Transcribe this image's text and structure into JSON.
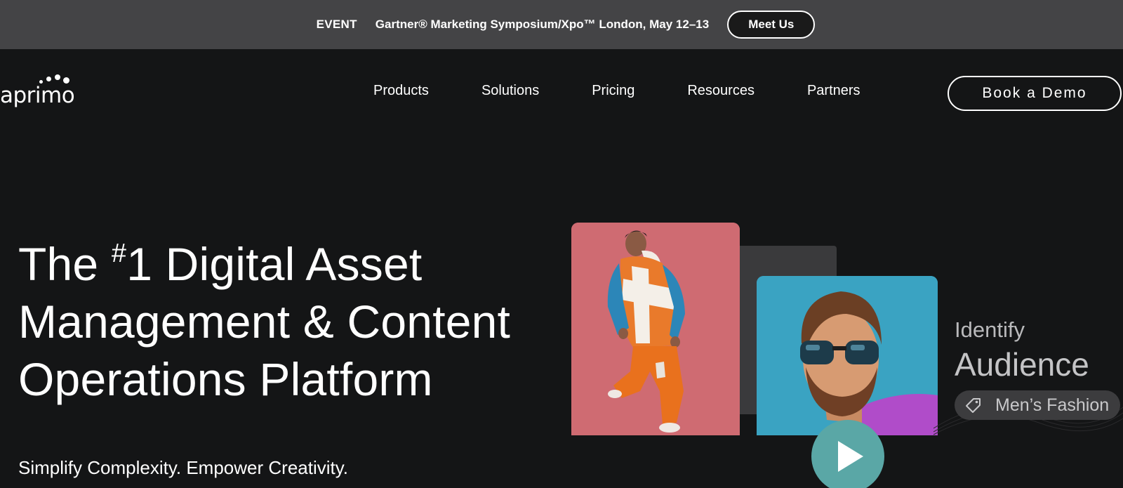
{
  "announcement": {
    "tag": "EVENT",
    "text": "Gartner® Marketing Symposium/Xpo™ London, May 12–13",
    "cta_label": "Meet Us"
  },
  "header": {
    "logo_text": "aprimo",
    "nav": [
      {
        "label": "Products"
      },
      {
        "label": "Solutions"
      },
      {
        "label": "Pricing"
      },
      {
        "label": "Resources"
      },
      {
        "label": "Partners"
      }
    ],
    "cta_label": "Book a Demo"
  },
  "hero": {
    "title_line1_prefix": "The ",
    "title_sup": "#",
    "title_line1_rest": "1 Digital Asset",
    "title_line2": "Management & Content",
    "title_line3": "Operations Platform",
    "subtitle": "Simplify Complexity. Empower Creativity."
  },
  "media": {
    "label_small": "Identify",
    "label_large": "Audience",
    "tag_label": "Men’s Fashion",
    "tag_icon": "tag-icon",
    "play_icon": "play-icon"
  },
  "colors": {
    "page_bg": "#141516",
    "announcement_bg": "#444446",
    "card_pink": "#cf6b72",
    "card_blue": "#3aa3c2",
    "play_button": "#5aa7a6"
  }
}
